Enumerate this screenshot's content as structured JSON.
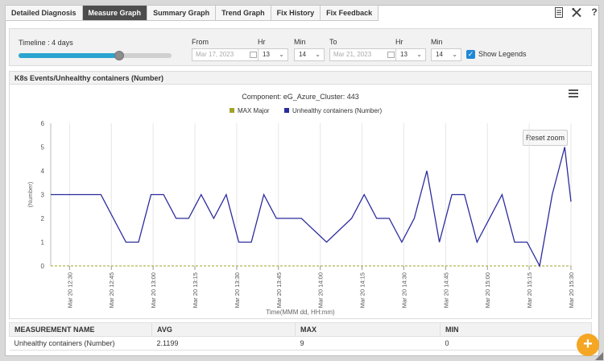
{
  "tabs": [
    {
      "label": "Detailed Diagnosis",
      "active": false
    },
    {
      "label": "Measure Graph",
      "active": true
    },
    {
      "label": "Summary Graph",
      "active": false
    },
    {
      "label": "Trend Graph",
      "active": false
    },
    {
      "label": "Fix History",
      "active": false
    },
    {
      "label": "Fix Feedback",
      "active": false
    }
  ],
  "toolbar": {
    "icons": [
      "document-icon",
      "tools-icon",
      "help-icon"
    ],
    "help_glyph": "?"
  },
  "timeline": {
    "label": "Timeline : 4 days",
    "progress": 0.66,
    "from_label": "From",
    "from_date": "Mar 17, 2023",
    "hr_label": "Hr",
    "min_label": "Min",
    "from_hr": "13",
    "from_min": "14",
    "to_label": "To",
    "to_date": "Mar 21, 2023",
    "to_hr": "13",
    "to_min": "14",
    "show_legends_label": "Show Legends",
    "show_legends_checked": true
  },
  "chart_panel": {
    "title": "K8s Events/Unhealthy containers (Number)",
    "reset_zoom": "Reset zoom"
  },
  "chart_data": {
    "type": "line",
    "title": "Component: eG_Azure_Cluster: 443",
    "xlabel": "Time(MMM dd, HH:mm)",
    "ylabel": "(Number)",
    "ylim": [
      0,
      6
    ],
    "yticks": [
      "0",
      "1",
      "2",
      "3",
      "4",
      "5",
      "6"
    ],
    "grid": "vertical",
    "legend_position": "top-center",
    "x_ticks": [
      "Mar 20 12:30",
      "Mar 20 12:45",
      "Mar 20 13:00",
      "Mar 20 13:15",
      "Mar 20 13:30",
      "Mar 20 13:45",
      "Mar 20 14:00",
      "Mar 20 14:15",
      "Mar 20 14:30",
      "Mar 20 14:45",
      "Mar 20 15:00",
      "Mar 20 15:15",
      "Mar 20 15:30"
    ],
    "x_range": [
      -0.45,
      12
    ],
    "series": [
      {
        "name": "MAX Major",
        "color": "#a3a329",
        "values_constant": 0,
        "style": "dashed"
      },
      {
        "name": "Unhealthy containers (Number)",
        "color": "#2b2b9e",
        "x": [
          -0.45,
          0.15,
          0.75,
          1.05,
          1.35,
          1.65,
          1.95,
          2.25,
          2.55,
          2.85,
          3.15,
          3.45,
          3.75,
          4.05,
          4.35,
          4.65,
          4.95,
          5.25,
          5.55,
          6.15,
          6.75,
          7.05,
          7.35,
          7.65,
          7.95,
          8.25,
          8.55,
          8.85,
          9.15,
          9.45,
          9.75,
          10.35,
          10.65,
          10.95,
          11.25,
          11.55,
          11.85,
          12.0
        ],
        "y": [
          3,
          3,
          3,
          2,
          1,
          1,
          3,
          3,
          2,
          2,
          3,
          2,
          3,
          1,
          1,
          3,
          2,
          2,
          2,
          1,
          2,
          3,
          2,
          2,
          1,
          2,
          4,
          1,
          3,
          3,
          1,
          3,
          1,
          1,
          0,
          3,
          5,
          2.7
        ]
      }
    ]
  },
  "stats_table": {
    "headers": [
      "MEASUREMENT NAME",
      "AVG",
      "MAX",
      "MIN"
    ],
    "row": [
      "Unhealthy containers (Number)",
      "2.1199",
      "9",
      "0"
    ]
  },
  "fab_glyph": "+"
}
